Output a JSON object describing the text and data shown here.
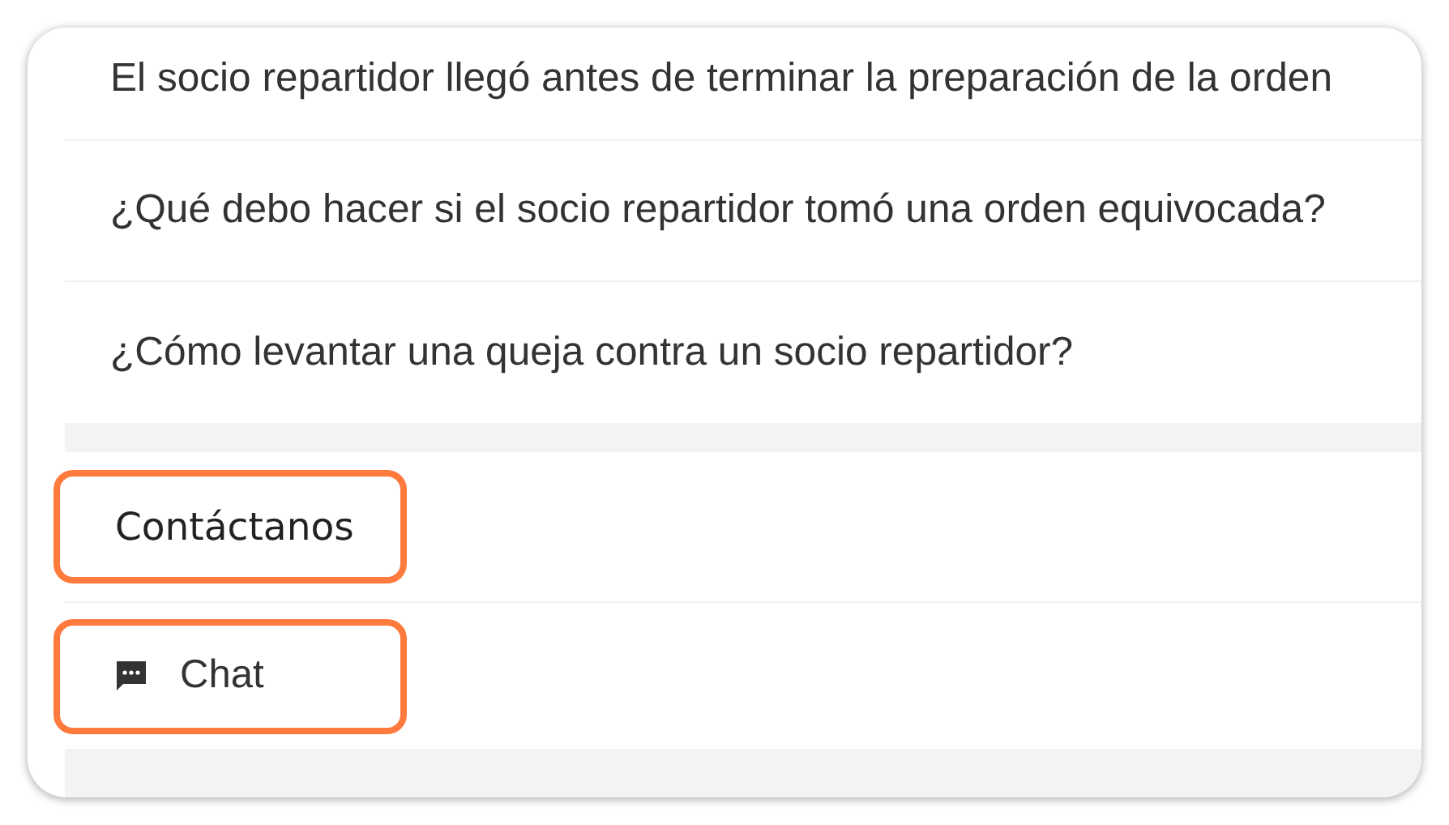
{
  "questions": [
    {
      "text": "El socio repartidor llegó antes de terminar la preparación de la orden"
    },
    {
      "text": "¿Qué debo hacer si el socio repartidor tomó una orden equivocada?"
    },
    {
      "text": "¿Cómo levantar una queja contra un socio repartidor?"
    }
  ],
  "contact": {
    "heading": {
      "text": "Contáctanos",
      "highlighted": true
    },
    "options": [
      {
        "label": "Chat",
        "kind": "chat",
        "highlighted": true
      }
    ]
  }
}
